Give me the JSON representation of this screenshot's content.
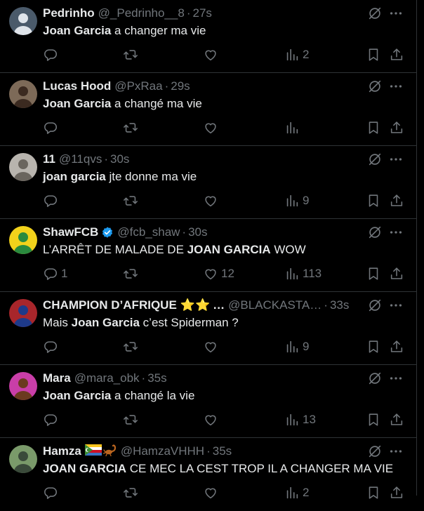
{
  "tweets": [
    {
      "name": "Pedrinho",
      "handle": "@_Pedrinho__8",
      "time": "27s",
      "segments": [
        {
          "text": "Joan Garcia",
          "bold": true
        },
        {
          "text": " a changer ma vie",
          "bold": false
        }
      ],
      "replies": "",
      "reposts": "",
      "likes": "",
      "views": "2",
      "avatar_colors": [
        "#4a5a6a",
        "#dfe4ea"
      ]
    },
    {
      "name": "Lucas Hood",
      "handle": "@PxRaa",
      "time": "29s",
      "segments": [
        {
          "text": "Joan Garcia",
          "bold": true
        },
        {
          "text": " a changé ma vie",
          "bold": false
        }
      ],
      "replies": "",
      "reposts": "",
      "likes": "",
      "views": "",
      "avatar_colors": [
        "#7d6a58",
        "#3b2a20"
      ]
    },
    {
      "name": "11",
      "handle": "@11qvs",
      "time": "30s",
      "segments": [
        {
          "text": "joan garcia",
          "bold": true
        },
        {
          "text": " jte donne ma vie",
          "bold": false
        }
      ],
      "replies": "",
      "reposts": "",
      "likes": "",
      "views": "9",
      "avatar_colors": [
        "#b8b4ae",
        "#6a655e"
      ]
    },
    {
      "name": "ShawFCB",
      "handle": "@fcb_shaw",
      "time": "30s",
      "verified": true,
      "segments": [
        {
          "text": "L’ARRÊT DE MALADE DE ",
          "bold": false
        },
        {
          "text": "JOAN GARCIA",
          "bold": true
        },
        {
          "text": " WOW",
          "bold": false
        }
      ],
      "replies": "1",
      "reposts": "",
      "likes": "12",
      "views": "113",
      "avatar_colors": [
        "#f2d21b",
        "#2a8a3e"
      ]
    },
    {
      "name": "CHAMPION D’AFRIQUE",
      "emoji": "⭐⭐",
      "ellipsis": "…",
      "handle": "@BLACKASTA…",
      "time": "33s",
      "segments": [
        {
          "text": "Mais ",
          "bold": false
        },
        {
          "text": "Joan Garcia",
          "bold": true
        },
        {
          "text": " c’est Spiderman ?",
          "bold": false
        }
      ],
      "replies": "",
      "reposts": "",
      "likes": "",
      "views": "9",
      "avatar_colors": [
        "#a8262b",
        "#1e3a8a"
      ]
    },
    {
      "name": "Mara",
      "handle": "@mara_obk",
      "time": "35s",
      "segments": [
        {
          "text": "Joan Garcia",
          "bold": true
        },
        {
          "text": " a changé la vie",
          "bold": false
        }
      ],
      "replies": "",
      "reposts": "",
      "likes": "",
      "views": "13",
      "avatar_colors": [
        "#c93ea8",
        "#6b3a1f"
      ]
    },
    {
      "name": "Hamza",
      "flag": "comoros",
      "handle": "@HamzaVHHH",
      "time": "35s",
      "segments": [
        {
          "text": "JOAN GARCIA",
          "bold": true
        },
        {
          "text": " CE MEC LA CEST TROP IL A CHANGER MA VIE",
          "bold": false
        }
      ],
      "replies": "",
      "reposts": "",
      "likes": "",
      "views": "2",
      "avatar_colors": [
        "#7a9a6a",
        "#3a4a3a"
      ]
    }
  ],
  "colors": {
    "background": "#000000",
    "text": "#e7e9ea",
    "muted": "#71767b",
    "border": "#2f3336",
    "verified": "#1d9bf0"
  }
}
